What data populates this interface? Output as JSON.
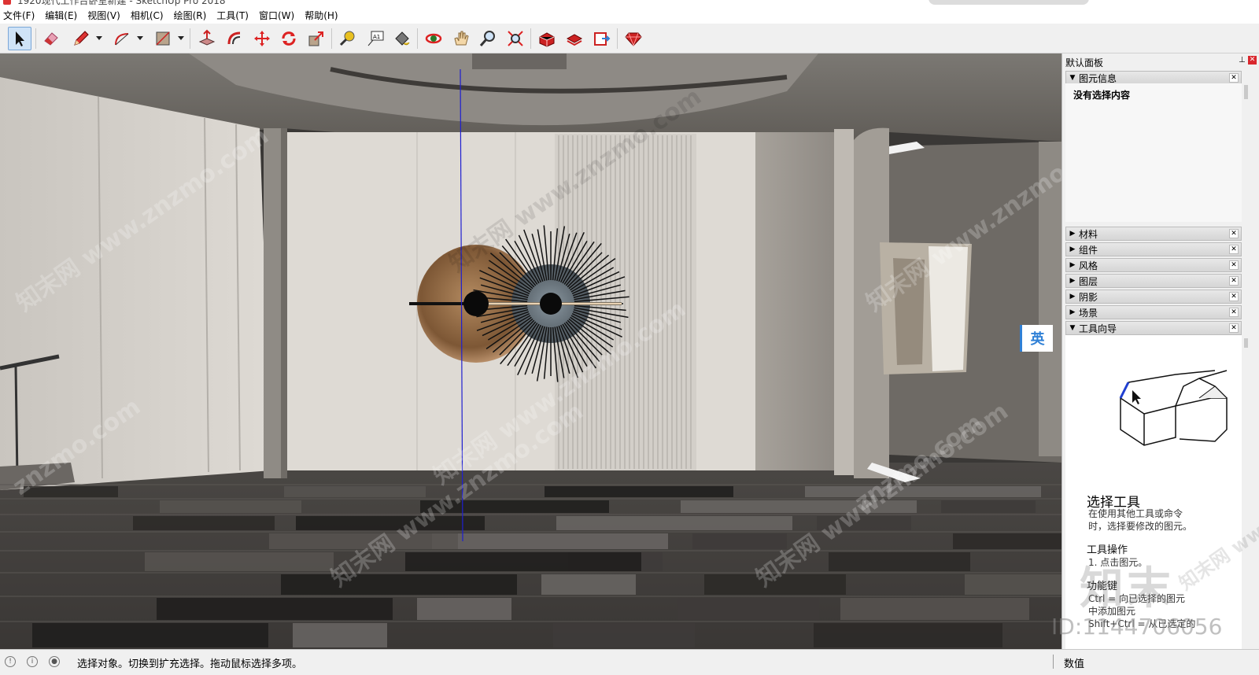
{
  "window": {
    "title": "1920现代工作台卧室新建 - SketchUp Pro 2018"
  },
  "menu": [
    "文件(F)",
    "编辑(E)",
    "视图(V)",
    "相机(C)",
    "绘图(R)",
    "工具(T)",
    "窗口(W)",
    "帮助(H)"
  ],
  "toolbar": {
    "tools": [
      {
        "name": "select-tool",
        "icon": "arrow-icon",
        "active": true
      },
      {
        "name": "eraser-tool",
        "icon": "eraser-icon"
      },
      {
        "name": "line-tool",
        "icon": "pencil-icon"
      },
      {
        "name": "arc-tool",
        "icon": "arc-icon"
      },
      {
        "name": "rectangle-tool",
        "icon": "rectangle-icon"
      },
      {
        "name": "push-pull-tool",
        "icon": "push-pull-icon"
      },
      {
        "name": "offset-tool",
        "icon": "offset-icon"
      },
      {
        "name": "move-tool",
        "icon": "move-icon"
      },
      {
        "name": "rotate-tool",
        "icon": "rotate-icon"
      },
      {
        "name": "scale-tool",
        "icon": "scale-icon"
      },
      {
        "name": "tape-measure-tool",
        "icon": "tape-measure-icon"
      },
      {
        "name": "text-tool",
        "icon": "text-icon"
      },
      {
        "name": "paint-bucket-tool",
        "icon": "paint-bucket-icon"
      },
      {
        "name": "orbit-tool",
        "icon": "orbit-icon"
      },
      {
        "name": "pan-tool",
        "icon": "hand-icon"
      },
      {
        "name": "zoom-tool",
        "icon": "magnifier-icon"
      },
      {
        "name": "zoom-extents-tool",
        "icon": "zoom-extents-icon"
      },
      {
        "name": "warehouse-tool",
        "icon": "warehouse-icon"
      },
      {
        "name": "extension-warehouse-tool",
        "icon": "extension-icon"
      },
      {
        "name": "layout-send-tool",
        "icon": "layout-icon"
      },
      {
        "name": "ruby-console-tool",
        "icon": "ruby-icon"
      }
    ],
    "text_tool_label": "A1"
  },
  "viewport": {
    "ime_badge": "英",
    "watermarks": [
      "知末网 www.znzmo.com",
      "znzmo.com"
    ]
  },
  "tray": {
    "title": "默认面板",
    "entity_info": {
      "label": "图元信息",
      "message": "没有选择内容"
    },
    "panels": [
      "材料",
      "组件",
      "风格",
      "图层",
      "阴影",
      "场景"
    ],
    "instructor": {
      "label": "工具向导",
      "tool_title": "选择工具",
      "desc1": "在使用其他工具或命令",
      "desc2": "时，选择要修改的图元。",
      "ops_title": "工具操作",
      "op1": "1. 点击图元。",
      "func_title": "功能键",
      "func1": "Ctrl = 向已选择的图元",
      "func2": "中添加图元",
      "func3": "Shift+Ctrl = 从已选定的"
    },
    "overlay_logo": "知末",
    "overlay_id": "ID:1144706056"
  },
  "statusbar": {
    "text": "选择对象。切换到扩充选择。拖动鼠标选择多项。",
    "value_label": "数值",
    "value": ""
  },
  "colors": {
    "accent": "#2f80d6",
    "close_red": "#d9272e",
    "axis_blue": "#1f1fd0"
  }
}
